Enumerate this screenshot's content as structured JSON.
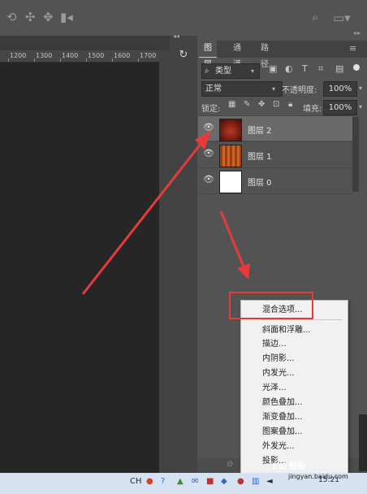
{
  "topbar": {
    "icons": [
      "rotate-3d-icon",
      "pan-3d-icon",
      "slide-3d-icon",
      "video-camera-icon"
    ],
    "search_icon": "search-icon",
    "workspace_icon": "workspace-icon"
  },
  "ruler": {
    "ticks": [
      "1200",
      "1300",
      "1400",
      "1500",
      "1600",
      "1700"
    ]
  },
  "panel": {
    "tabs": [
      {
        "label": "图层",
        "active": true
      },
      {
        "label": "通道",
        "active": false
      },
      {
        "label": "路径",
        "active": false
      }
    ],
    "filter": {
      "kind_label": "类型"
    },
    "blend_mode": "正常",
    "opacity_label": "不透明度:",
    "opacity_value": "100%",
    "lock_label": "锁定:",
    "fill_label": "填充:",
    "fill_value": "100%",
    "layers": [
      {
        "name": "图层 2",
        "selected": true
      },
      {
        "name": "图层 1",
        "selected": false
      },
      {
        "name": "图层 0",
        "selected": false
      }
    ]
  },
  "context_menu": {
    "items": [
      "混合选项...",
      "斜面和浮雕...",
      "描边...",
      "内阴影...",
      "内发光...",
      "光泽...",
      "颜色叠加...",
      "渐变叠加...",
      "图案叠加...",
      "外发光...",
      "投影..."
    ]
  },
  "watermark": {
    "text": "Bai 经验",
    "url": "jingyan.baidu.com"
  },
  "taskbar": {
    "ime": "CH",
    "clock": "15:21"
  },
  "colors": {
    "annotation": "#e63b3b",
    "panel_bg": "#535353",
    "canvas": "#262626"
  }
}
